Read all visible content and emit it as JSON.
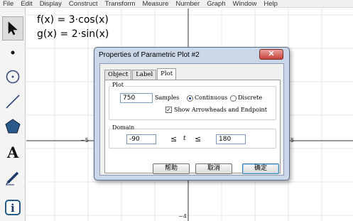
{
  "menu": [
    "File",
    "Edit",
    "Display",
    "Construct",
    "Transform",
    "Measure",
    "Number",
    "Graph",
    "Window",
    "Help"
  ],
  "toolbox": [
    "arrow-select-tool",
    "point-tool",
    "compass-tool",
    "straightedge-tool",
    "polygon-tool",
    "text-tool",
    "marker-tool",
    "information-tool"
  ],
  "functions": {
    "f": "f(x) = 3·cos(x)",
    "g": "g(x) = 2·sin(x)"
  },
  "axes": {
    "x_tick_left": "−5",
    "x_tick_right": "5",
    "y_tick_bottom": "−4"
  },
  "dialog": {
    "title": "Properties of Parametric Plot #2",
    "close": "✕",
    "tabs": [
      "Object",
      "Label",
      "Plot"
    ],
    "plot_group": "Plot",
    "samples_value": "750",
    "samples_label": "Samples",
    "continuous_label": "Continuous",
    "discrete_label": "Discrete",
    "show_arrowheads_label": "Show Arrowheads and Endpoint",
    "domain_group": "Domain",
    "domain_min": "-90",
    "leq1": "≤",
    "t_symbol": "t",
    "leq2": "≤",
    "domain_max": "180",
    "help_button": "帮助",
    "cancel_button": "取消",
    "ok_button": "确定"
  }
}
